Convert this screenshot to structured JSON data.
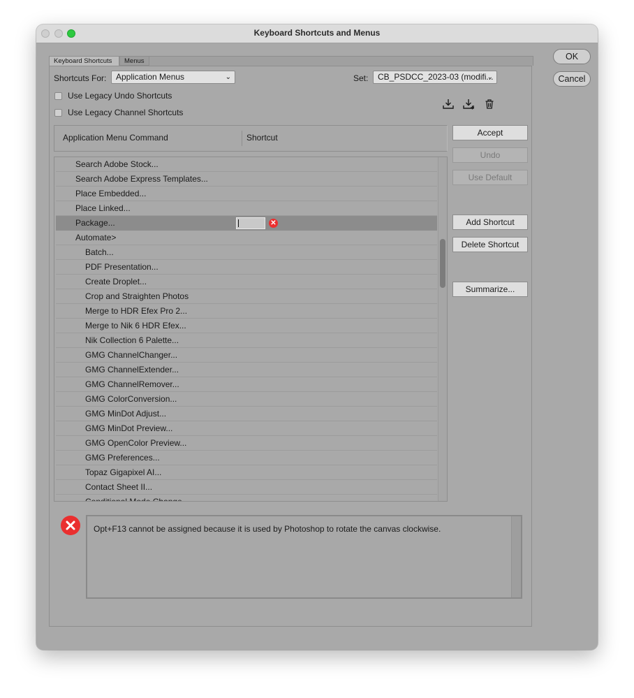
{
  "window": {
    "title": "Keyboard Shortcuts and Menus"
  },
  "tabs": {
    "keyboard_shortcuts": "Keyboard Shortcuts",
    "menus": "Menus"
  },
  "shortcuts_for": {
    "label": "Shortcuts For:",
    "value": "Application Menus"
  },
  "set": {
    "label": "Set:",
    "value": "CB_PSDCC_2023-03 (modifi..."
  },
  "options": {
    "legacy_undo": "Use Legacy Undo Shortcuts",
    "legacy_channel": "Use Legacy Channel Shortcuts"
  },
  "set_icons": [
    "save-set-icon",
    "save-as-set-icon",
    "delete-set-icon"
  ],
  "table": {
    "col_command": "Application Menu Command",
    "col_shortcut": "Shortcut"
  },
  "rows": [
    {
      "label": "Search Adobe Stock...",
      "indent": 1
    },
    {
      "label": "Search Adobe Express Templates...",
      "indent": 1
    },
    {
      "label": "Place Embedded...",
      "indent": 1
    },
    {
      "label": "Place Linked...",
      "indent": 1
    },
    {
      "label": "Package...",
      "indent": 1,
      "selected": true
    },
    {
      "label": "Automate>",
      "indent": 1
    },
    {
      "label": "Batch...",
      "indent": 2
    },
    {
      "label": "PDF Presentation...",
      "indent": 2
    },
    {
      "label": "Create Droplet...",
      "indent": 2
    },
    {
      "label": "Crop and Straighten Photos",
      "indent": 2
    },
    {
      "label": "Merge to HDR Efex Pro 2...",
      "indent": 2
    },
    {
      "label": "Merge to Nik 6 HDR Efex...",
      "indent": 2
    },
    {
      "label": "Nik Collection 6 Palette...",
      "indent": 2
    },
    {
      "label": "GMG ChannelChanger...",
      "indent": 2
    },
    {
      "label": "GMG ChannelExtender...",
      "indent": 2
    },
    {
      "label": "GMG ChannelRemover...",
      "indent": 2
    },
    {
      "label": "GMG ColorConversion...",
      "indent": 2
    },
    {
      "label": "GMG MinDot Adjust...",
      "indent": 2
    },
    {
      "label": "GMG MinDot Preview...",
      "indent": 2
    },
    {
      "label": "GMG OpenColor Preview...",
      "indent": 2
    },
    {
      "label": "GMG Preferences...",
      "indent": 2
    },
    {
      "label": "Topaz Gigapixel AI...",
      "indent": 2
    },
    {
      "label": "Contact Sheet II...",
      "indent": 2
    },
    {
      "label": "Conditional Mode Change...",
      "indent": 2
    }
  ],
  "buttons": {
    "ok": "OK",
    "cancel": "Cancel",
    "accept": "Accept",
    "undo": "Undo",
    "use_default": "Use Default",
    "add_shortcut": "Add Shortcut",
    "delete_shortcut": "Delete Shortcut",
    "summarize": "Summarize..."
  },
  "message": "Opt+F13 cannot be assigned because it is used by Photoshop to rotate the canvas clockwise.",
  "colors": {
    "error": "#ea2f2f",
    "zoom_button": "#2dc93f",
    "selected_row": "#8c8c8c"
  }
}
